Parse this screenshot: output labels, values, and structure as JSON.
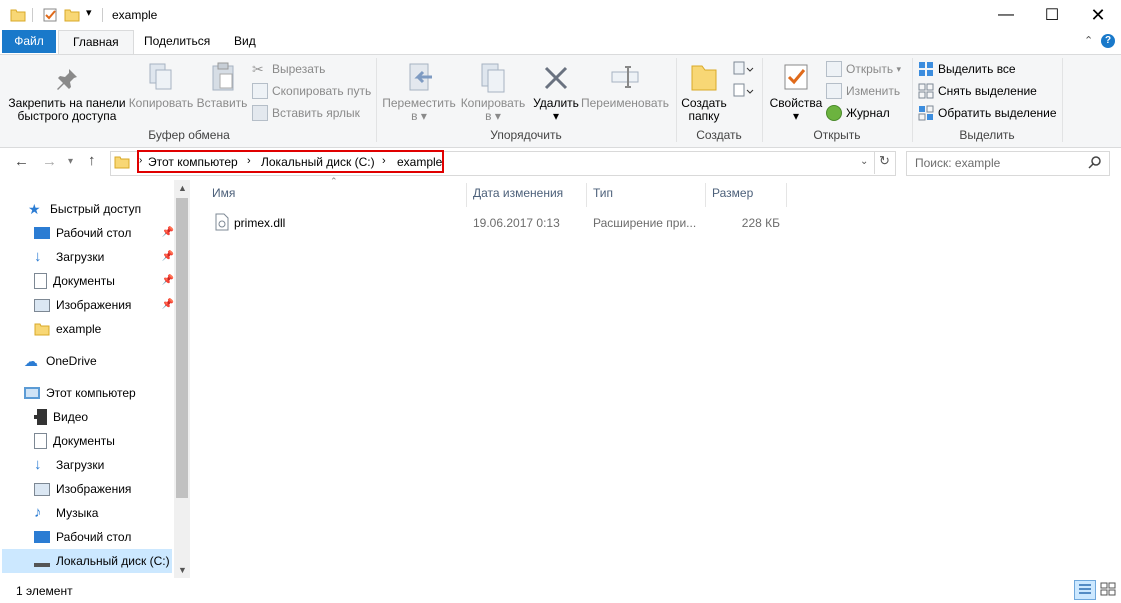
{
  "window": {
    "title": "example"
  },
  "tabs": {
    "file": "Файл",
    "home": "Главная",
    "share": "Поделиться",
    "view": "Вид"
  },
  "ribbon": {
    "pin_label_1": "Закрепить на панели",
    "pin_label_2": "быстрого доступа",
    "copy": "Копировать",
    "paste": "Вставить",
    "cut": "Вырезать",
    "copy_path": "Скопировать путь",
    "paste_shortcut": "Вставить ярлык",
    "group_clipboard": "Буфер обмена",
    "move_to_1": "Переместить",
    "move_to_2": "в",
    "copy_to_1": "Копировать",
    "copy_to_2": "в",
    "delete": "Удалить",
    "rename": "Переименовать",
    "group_organize": "Упорядочить",
    "new_folder_1": "Создать",
    "new_folder_2": "папку",
    "group_new": "Создать",
    "properties": "Свойства",
    "open": "Открыть",
    "edit": "Изменить",
    "history": "Журнал",
    "group_open": "Открыть",
    "select_all": "Выделить все",
    "select_none": "Снять выделение",
    "invert_selection": "Обратить выделение",
    "group_select": "Выделить"
  },
  "address": {
    "crumbs": [
      "Этот компьютер",
      "Локальный диск (C:)",
      "example"
    ],
    "search_placeholder": "Поиск: example"
  },
  "nav": {
    "quick_access": "Быстрый доступ",
    "quick_items": [
      "Рабочий стол",
      "Загрузки",
      "Документы",
      "Изображения",
      "example"
    ],
    "onedrive": "OneDrive",
    "this_pc": "Этот компьютер",
    "pc_items": [
      "Видео",
      "Документы",
      "Загрузки",
      "Изображения",
      "Музыка",
      "Рабочий стол",
      "Локальный диск (C:)"
    ]
  },
  "columns": {
    "name": "Имя",
    "date": "Дата изменения",
    "type": "Тип",
    "size": "Размер"
  },
  "files": [
    {
      "name": "primex.dll",
      "date": "19.06.2017 0:13",
      "type": "Расширение при...",
      "size": "228 КБ"
    }
  ],
  "status": {
    "count": "1 элемент"
  },
  "colors": {
    "accent": "#1979ca",
    "highlight": "#e00000",
    "selected": "#cce8ff"
  }
}
